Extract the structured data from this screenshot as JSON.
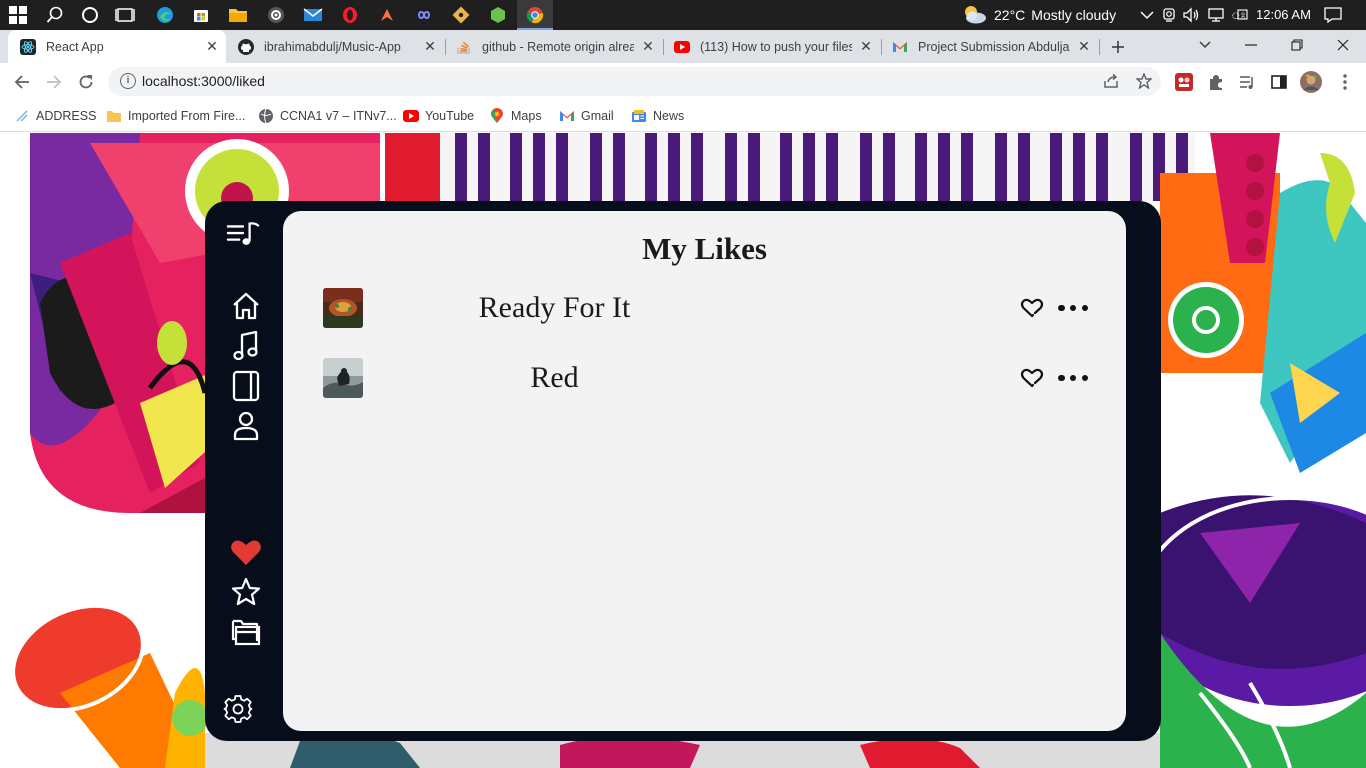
{
  "taskbar": {
    "weather_temp": "22°C",
    "weather_desc": "Mostly cloudy",
    "clock": "12:06 AM"
  },
  "browser": {
    "tabs": [
      {
        "title": "React App",
        "active": true
      },
      {
        "title": "ibrahimabdulj/Music-App",
        "active": false
      },
      {
        "title": "github - Remote origin alrea",
        "active": false
      },
      {
        "title": "(113) How to push your files",
        "active": false
      },
      {
        "title": "Project Submission Abduljab",
        "active": false
      }
    ],
    "url": "localhost:3000/liked",
    "bookmarks": [
      {
        "label": "ADDRESS"
      },
      {
        "label": "Imported From Fire..."
      },
      {
        "label": "CCNA1 v7 – ITNv7..."
      },
      {
        "label": "YouTube"
      },
      {
        "label": "Maps"
      },
      {
        "label": "Gmail"
      },
      {
        "label": "News"
      }
    ]
  },
  "app": {
    "page_title": "My Likes",
    "songs": [
      {
        "title": "Ready For It",
        "liked": true
      },
      {
        "title": "Red",
        "liked": true
      }
    ],
    "colors": {
      "frame": "#070d1a",
      "panel": "#f3f3f4",
      "heart_active": "#e53935"
    },
    "sidebar_icons": [
      "menu-music-icon",
      "home-icon",
      "music-note-icon",
      "device-icon",
      "user-icon",
      "heart-icon",
      "star-icon",
      "folder-icon",
      "settings-icon"
    ]
  }
}
